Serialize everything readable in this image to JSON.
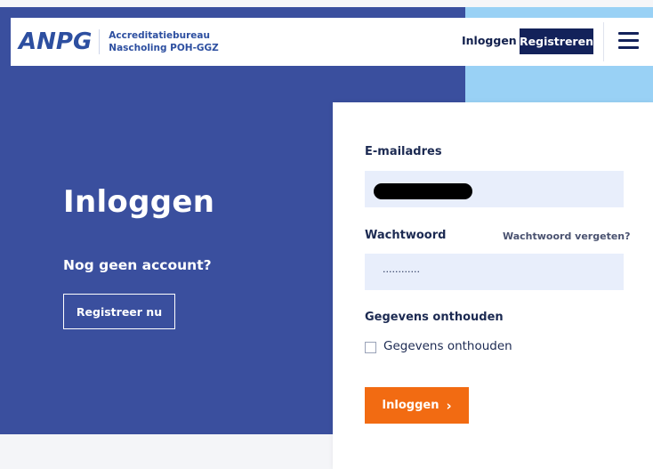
{
  "header": {
    "logo": "ANPG",
    "logo_sub_line1": "Accreditatiebureau",
    "logo_sub_line2": "Nascholing POH-GGZ",
    "login_link": "Inloggen",
    "register_button": "Registreren",
    "menu_icon": "hamburger-menu-icon"
  },
  "hero": {
    "title": "Inloggen",
    "subtitle": "Nog geen account?",
    "register_now_button": "Registreer nu"
  },
  "form": {
    "email_label": "E-mailadres",
    "email_value": "",
    "password_label": "Wachtwoord",
    "forgot_password_link": "Wachtwoord vergeten?",
    "password_value": "············",
    "remember_section_label": "Gegevens onthouden",
    "remember_checkbox_label": "Gegevens onthouden",
    "remember_checked": false,
    "submit_button": "Inloggen",
    "submit_chevron": "›"
  },
  "colors": {
    "hero_blue": "#3a4f9e",
    "navy": "#13225a",
    "accent_orange": "#f26b12",
    "light_blue": "#99d1f5",
    "input_bg": "#e8eefb"
  }
}
